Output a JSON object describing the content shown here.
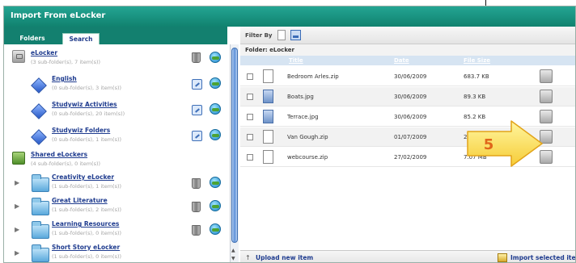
{
  "window": {
    "title": "Import From eLocker"
  },
  "tabs": [
    {
      "label": "Folders"
    },
    {
      "label": "Search"
    }
  ],
  "tree": [
    {
      "title": "eLocker",
      "subtitle": "(3 sub-folder(s), 7 item(s))",
      "icon": "locker-icon"
    },
    {
      "title": "English",
      "subtitle": "(0 sub-folder(s), 3 item(s))",
      "icon": "diamond-icon"
    },
    {
      "title": "Studywiz Activities",
      "subtitle": "(0 sub-folder(s), 20 item(s))",
      "icon": "diamond-icon"
    },
    {
      "title": "Studywiz Folders",
      "subtitle": "(0 sub-folder(s), 1 item(s))",
      "icon": "diamond-icon"
    },
    {
      "title": "Shared eLockers",
      "subtitle": "(4 sub-folder(s), 0 item(s))",
      "icon": "shared-icon"
    },
    {
      "title": "Creativity eLocker",
      "subtitle": "(1 sub-folder(s), 1 item(s))",
      "icon": "folder-icon"
    },
    {
      "title": "Great Literature",
      "subtitle": "(1 sub-folder(s), 2 item(s))",
      "icon": "folder-icon"
    },
    {
      "title": "Learning Resources",
      "subtitle": "(1 sub-folder(s), 0 item(s))",
      "icon": "folder-icon"
    },
    {
      "title": "Short Story eLocker",
      "subtitle": "(1 sub-folder(s), 0 item(s))",
      "icon": "folder-icon"
    }
  ],
  "filter": {
    "label": "Filter By"
  },
  "folder": {
    "label": "Folder: eLocker"
  },
  "columns": {
    "title": "Title",
    "date": "Date",
    "size": "File Size"
  },
  "files": [
    {
      "name": "Bedroom Arles.zip",
      "date": "30/06/2009",
      "size": "683.7 KB",
      "type": "zip"
    },
    {
      "name": "Boats.jpg",
      "date": "30/06/2009",
      "size": "89.3 KB",
      "type": "image"
    },
    {
      "name": "Terrace.jpg",
      "date": "30/06/2009",
      "size": "85.2 KB",
      "type": "image"
    },
    {
      "name": "Van Gough.zip",
      "date": "01/07/2009",
      "size": "260.",
      "type": "zip"
    },
    {
      "name": "webcourse.zip",
      "date": "27/02/2009",
      "size": "7.07 MB",
      "type": "zip"
    }
  ],
  "footer": {
    "upload": "Upload new item",
    "import": "Import selected items"
  },
  "callout": {
    "number": "5"
  },
  "colors": {
    "titlebar": "#13806f",
    "link": "#1f3c8f",
    "callout_fill": "#ffe566",
    "callout_text": "#e0661a"
  }
}
